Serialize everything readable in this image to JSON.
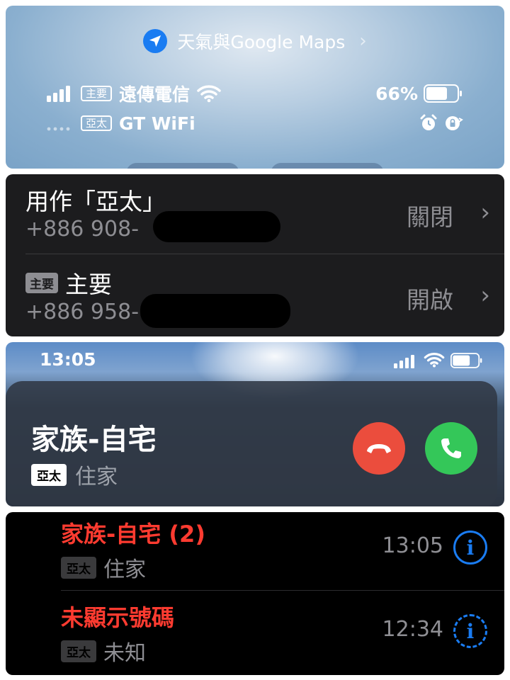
{
  "control_center": {
    "location_label": "天氣與Google Maps",
    "line1": {
      "sim_tag": "主要",
      "carrier": "遠傳電信",
      "battery": "66%"
    },
    "line2": {
      "sim_tag": "亞太",
      "carrier": "GT WiFi"
    }
  },
  "cellular_settings": {
    "rows": [
      {
        "title": "用作「亞太」",
        "number": "+886 908-",
        "value": "關閉"
      },
      {
        "tag": "主要",
        "title": "主要",
        "number": "+886 958-",
        "value": "開啟"
      }
    ]
  },
  "incoming_call": {
    "time": "13:05",
    "caller": "家族-自宅",
    "sim_tag": "亞太",
    "type": "住家"
  },
  "recents": {
    "items": [
      {
        "name": "家族-自宅 (2)",
        "sim_tag": "亞太",
        "label": "住家",
        "time": "13:05"
      },
      {
        "name": "未顯示號碼",
        "sim_tag": "亞太",
        "label": "未知",
        "time": "12:34"
      }
    ]
  },
  "colors": {
    "missed_red": "#ff3b30",
    "accent_blue": "#1a7cf2",
    "decline_red": "#eb4d3d",
    "accept_green": "#34c759"
  }
}
